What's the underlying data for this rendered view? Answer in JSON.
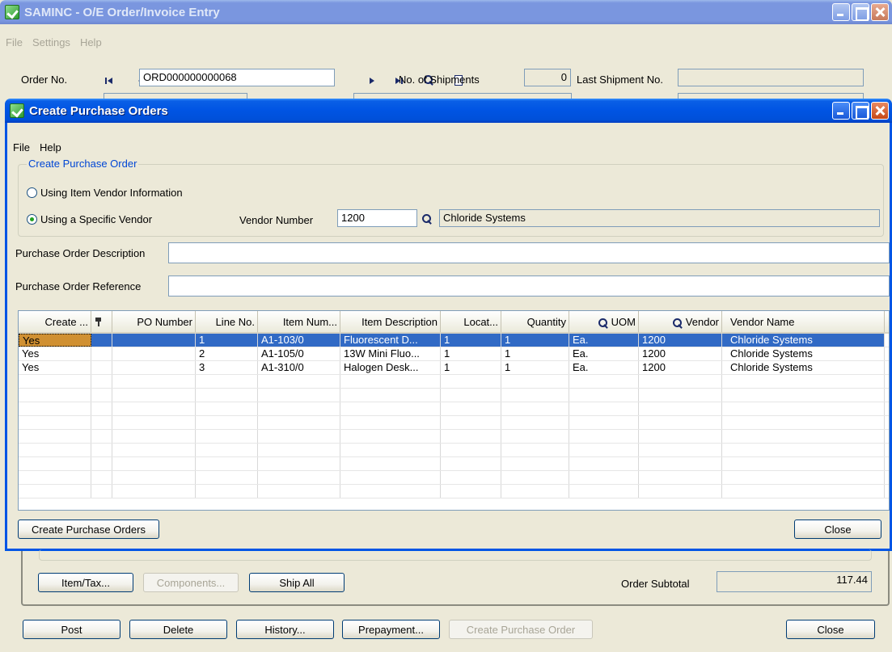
{
  "main_window": {
    "title": "SAMINC - O/E Order/Invoice Entry",
    "menu": [
      "File",
      "Settings",
      "Help"
    ],
    "order_no_label": "Order No.",
    "order_no_value": "ORD000000000068",
    "shipments_label": "No. of Shipments",
    "shipments_value": "0",
    "last_shipment_label": "Last Shipment No.",
    "last_shipment_value": "",
    "buttons": {
      "item_tax": "Item/Tax...",
      "components": "Components...",
      "ship_all": "Ship All",
      "post": "Post",
      "delete": "Delete",
      "history": "History...",
      "prepayment": "Prepayment...",
      "create_po": "Create Purchase Order",
      "close": "Close"
    },
    "order_subtotal_label": "Order Subtotal",
    "order_subtotal_value": "117.44"
  },
  "dialog": {
    "title": "Create Purchase Orders",
    "menu": [
      "File",
      "Help"
    ],
    "group_title": "Create Purchase Order",
    "radio_item_vendor": "Using  Item Vendor Information",
    "radio_specific_vendor": "Using a Specific Vendor",
    "selected_option": "specific_vendor",
    "vendor_number_label": "Vendor Number",
    "vendor_number_value": "1200",
    "vendor_name_value": "Chloride Systems",
    "po_description_label": "Purchase Order Description",
    "po_description_value": "",
    "po_reference_label": "Purchase Order Reference",
    "po_reference_value": "",
    "grid": {
      "headers": {
        "create": "Create ...",
        "po_number": "PO Number",
        "line_no": "Line No.",
        "item_number": "Item Num...",
        "item_description": "Item Description",
        "location": "Locat...",
        "quantity": "Quantity",
        "uom": "UOM",
        "vendor": "Vendor",
        "vendor_name": "Vendor Name"
      },
      "rows": [
        {
          "create": "Yes",
          "po_number": "",
          "line_no": "1",
          "item_number": "A1-103/0",
          "item_description": "Fluorescent D...",
          "location": "1",
          "quantity": "1",
          "uom": "Ea.",
          "vendor": "1200",
          "vendor_name": "Chloride Systems"
        },
        {
          "create": "Yes",
          "po_number": "",
          "line_no": "2",
          "item_number": "A1-105/0",
          "item_description": "13W Mini Fluo...",
          "location": "1",
          "quantity": "1",
          "uom": "Ea.",
          "vendor": "1200",
          "vendor_name": "Chloride Systems"
        },
        {
          "create": "Yes",
          "po_number": "",
          "line_no": "3",
          "item_number": "A1-310/0",
          "item_description": "Halogen Desk...",
          "location": "1",
          "quantity": "1",
          "uom": "Ea.",
          "vendor": "1200",
          "vendor_name": "Chloride Systems"
        }
      ],
      "selected_row": 0
    },
    "create_button": "Create Purchase Orders",
    "close_button": "Close"
  }
}
